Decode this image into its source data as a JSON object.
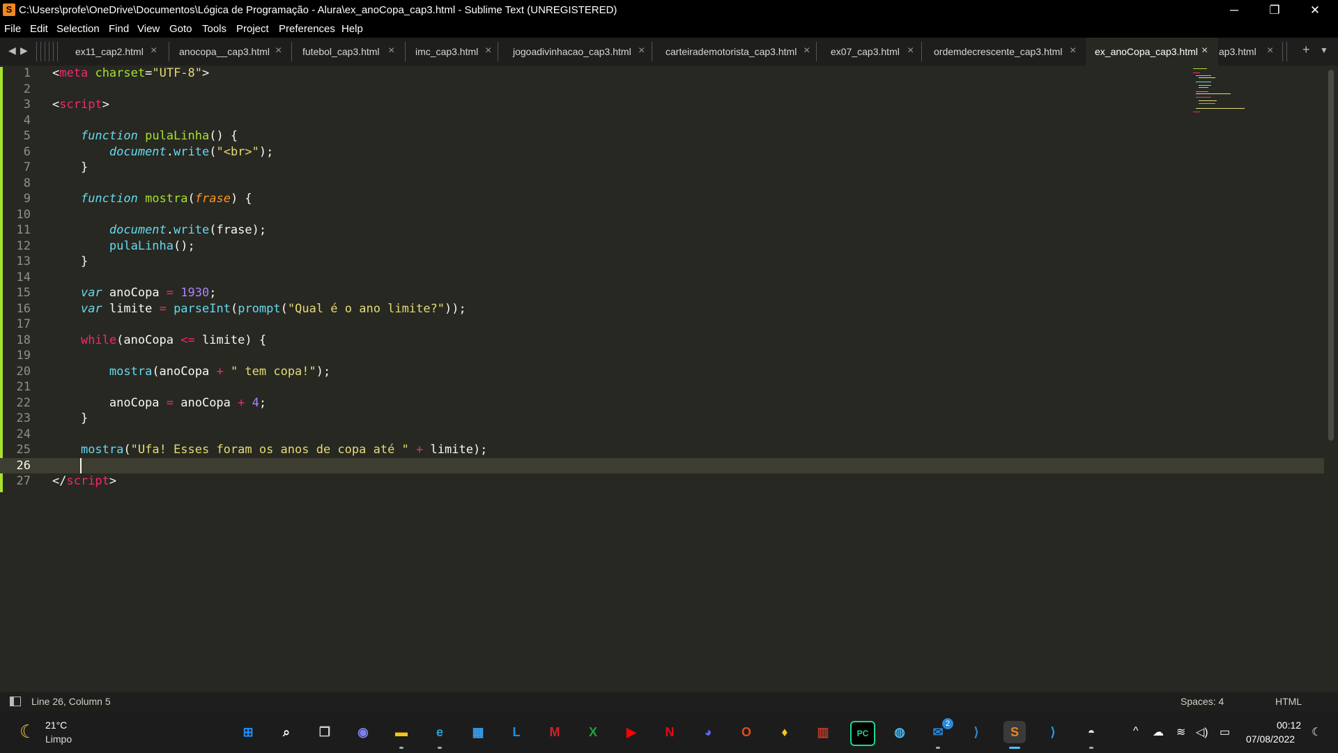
{
  "window": {
    "title": "C:\\Users\\profe\\OneDrive\\Documentos\\Lógica de Programação - Alura\\ex_anoCopa_cap3.html - Sublime Text (UNREGISTERED)",
    "app_icon": "S",
    "minimize": "─",
    "restore": "❐",
    "close": "✕"
  },
  "menu": {
    "items": [
      "File",
      "Edit",
      "Selection",
      "Find",
      "View",
      "Goto",
      "Tools",
      "Project",
      "Preferences",
      "Help"
    ]
  },
  "tabs": {
    "items": [
      {
        "label": "ex11_cap2.html"
      },
      {
        "label": "anocopa__cap3.html"
      },
      {
        "label": "futebol_cap3.html"
      },
      {
        "label": "imc_cap3.html"
      },
      {
        "label": "jogoadivinhacao_cap3.html"
      },
      {
        "label": "carteirademotorista_cap3.html"
      },
      {
        "label": "ex07_cap3.html"
      },
      {
        "label": "ordemdecrescente_cap3.html"
      },
      {
        "label": "ex_anoCopa_cap3.html"
      },
      {
        "label": "ap3.html"
      }
    ],
    "active_index": 8,
    "close_glyph": "×",
    "new_tab": "+",
    "overflow": "▼",
    "nav_left": "◀",
    "nav_right": "▶"
  },
  "editor": {
    "current_line": 26,
    "lines": [
      {
        "n": "1"
      },
      {
        "n": "2"
      },
      {
        "n": "3"
      },
      {
        "n": "4"
      },
      {
        "n": "5"
      },
      {
        "n": "6"
      },
      {
        "n": "7"
      },
      {
        "n": "8"
      },
      {
        "n": "9"
      },
      {
        "n": "10"
      },
      {
        "n": "11"
      },
      {
        "n": "12"
      },
      {
        "n": "13"
      },
      {
        "n": "14"
      },
      {
        "n": "15"
      },
      {
        "n": "16"
      },
      {
        "n": "17"
      },
      {
        "n": "18"
      },
      {
        "n": "19"
      },
      {
        "n": "20"
      },
      {
        "n": "21"
      },
      {
        "n": "22"
      },
      {
        "n": "23"
      },
      {
        "n": "24"
      },
      {
        "n": "25"
      },
      {
        "n": "26"
      },
      {
        "n": "27"
      }
    ],
    "code": {
      "l1": [
        "<",
        "meta",
        " ",
        "charset",
        "=",
        "\"UTF-8\"",
        ">"
      ],
      "l3": [
        "<",
        "script",
        ">"
      ],
      "l5": [
        "    ",
        "function",
        " ",
        "pulaLinha",
        "() {"
      ],
      "l6": [
        "        ",
        "document",
        ".",
        "write",
        "(",
        "\"<br>\"",
        ");"
      ],
      "l7": [
        "    }"
      ],
      "l9": [
        "    ",
        "function",
        " ",
        "mostra",
        "(",
        "frase",
        ") {"
      ],
      "l11": [
        "        ",
        "document",
        ".",
        "write",
        "(frase);"
      ],
      "l12": [
        "        ",
        "pulaLinha",
        "();"
      ],
      "l13": [
        "    }"
      ],
      "l15": [
        "    ",
        "var",
        " anoCopa ",
        "=",
        " ",
        "1930",
        ";"
      ],
      "l16": [
        "    ",
        "var",
        " limite ",
        "=",
        " ",
        "parseInt",
        "(",
        "prompt",
        "(",
        "\"Qual é o ano limite?\"",
        "));"
      ],
      "l18": [
        "    ",
        "while",
        "(anoCopa ",
        "<=",
        " limite) {"
      ],
      "l20": [
        "        ",
        "mostra",
        "(anoCopa ",
        "+",
        " ",
        "\" tem copa!\"",
        ");"
      ],
      "l22": [
        "        anoCopa ",
        "=",
        " anoCopa ",
        "+",
        " ",
        "4",
        ";"
      ],
      "l23": [
        "    }"
      ],
      "l25": [
        "    ",
        "mostra",
        "(",
        "\"Ufa! Esses foram os anos de copa até \"",
        " ",
        "+",
        " limite);"
      ],
      "l27": [
        "</",
        "script",
        ">"
      ]
    }
  },
  "status": {
    "position": "Line 26, Column 5",
    "indent": "Spaces: 4",
    "syntax": "HTML"
  },
  "taskbar": {
    "weather_temp": "21°C",
    "weather_desc": "Limpo",
    "weather_icon": "☾",
    "time": "00:12",
    "date": "07/08/2022",
    "mail_badge": "2",
    "apps": [
      {
        "name": "start-icon",
        "glyph": "⊞",
        "color": "#1e90ff"
      },
      {
        "name": "search-icon",
        "glyph": "⌕",
        "color": "#ffffff"
      },
      {
        "name": "task-view-icon",
        "glyph": "❐",
        "color": "#d0d0d0"
      },
      {
        "name": "teams-chat-icon",
        "glyph": "◉",
        "color": "#7b83eb"
      },
      {
        "name": "file-explorer-icon",
        "glyph": "▬",
        "color": "#f5c518"
      },
      {
        "name": "edge-icon",
        "glyph": "e",
        "color": "#1fa2e0"
      },
      {
        "name": "microsoft-store-icon",
        "glyph": "▦",
        "color": "#3aa0f0"
      },
      {
        "name": "lightroom-icon",
        "glyph": "L",
        "color": "#1d8fe0"
      },
      {
        "name": "mcafee-icon",
        "glyph": "M",
        "color": "#d32027"
      },
      {
        "name": "xbox-icon",
        "glyph": "X",
        "color": "#19a33d"
      },
      {
        "name": "youtube-icon",
        "glyph": "▶",
        "color": "#ff0000"
      },
      {
        "name": "netflix-icon",
        "glyph": "N",
        "color": "#e50914"
      },
      {
        "name": "discord-icon",
        "glyph": "◕",
        "color": "#5865f2"
      },
      {
        "name": "office-icon",
        "glyph": "O",
        "color": "#e64a19"
      },
      {
        "name": "tips-icon",
        "glyph": "♦",
        "color": "#f2c811"
      },
      {
        "name": "chart-app-icon",
        "glyph": "▥",
        "color": "#c0392b"
      },
      {
        "name": "pycharm-icon",
        "glyph": "PC",
        "color": "#21d789"
      },
      {
        "name": "maps-icon",
        "glyph": "◍",
        "color": "#4fb3e8"
      },
      {
        "name": "mail-icon",
        "glyph": "✉",
        "color": "#2b88d8"
      },
      {
        "name": "vscode-icon",
        "glyph": "⟩",
        "color": "#2f8bd6"
      },
      {
        "name": "sublime-text-icon",
        "glyph": "S",
        "color": "#f0871f"
      },
      {
        "name": "vscode-insiders-icon",
        "glyph": "⟩",
        "color": "#24a0ed"
      },
      {
        "name": "incognito-icon",
        "glyph": "◓",
        "color": "#e0e0e0"
      }
    ],
    "tray": {
      "chevron": "^",
      "onedrive": "☁",
      "wifi": "≋",
      "volume": "◁)",
      "battery": "▭",
      "quiet": "☾"
    }
  }
}
